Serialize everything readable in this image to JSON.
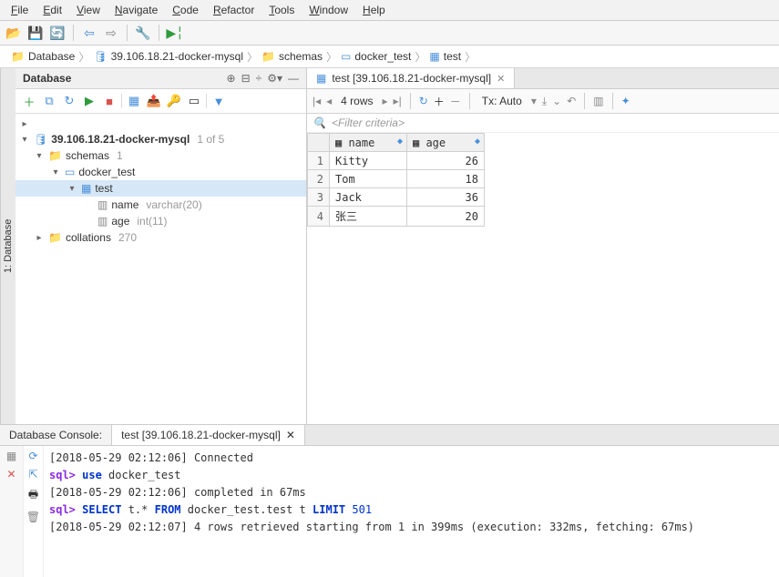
{
  "menu": [
    "File",
    "Edit",
    "View",
    "Navigate",
    "Code",
    "Refactor",
    "Tools",
    "Window",
    "Help"
  ],
  "breadcrumb": [
    {
      "icon": "folder",
      "label": "Database"
    },
    {
      "icon": "db",
      "label": "39.106.18.21-docker-mysql"
    },
    {
      "icon": "folder",
      "label": "schemas"
    },
    {
      "icon": "schema",
      "label": "docker_test"
    },
    {
      "icon": "table",
      "label": "test"
    }
  ],
  "vtab_label": "1: Database",
  "db_panel": {
    "title": "Database",
    "tree": [
      {
        "indent": 0,
        "arrow": "▸",
        "icon": "",
        "label": "",
        "meta": ""
      },
      {
        "indent": 0,
        "arrow": "▾",
        "icon": "db",
        "label": "39.106.18.21-docker-mysql",
        "meta": "1 of 5",
        "bold": true
      },
      {
        "indent": 1,
        "arrow": "▾",
        "icon": "folder",
        "label": "schemas",
        "meta": "1"
      },
      {
        "indent": 2,
        "arrow": "▾",
        "icon": "schema",
        "label": "docker_test",
        "meta": ""
      },
      {
        "indent": 3,
        "arrow": "▾",
        "icon": "table",
        "label": "test",
        "meta": "",
        "sel": true
      },
      {
        "indent": 4,
        "arrow": "",
        "icon": "col",
        "label": "name",
        "meta": "varchar(20)"
      },
      {
        "indent": 4,
        "arrow": "",
        "icon": "col",
        "label": "age",
        "meta": "int(11)"
      },
      {
        "indent": 1,
        "arrow": "▸",
        "icon": "folder",
        "label": "collations",
        "meta": "270"
      },
      {
        "indent": 0,
        "arrow": "",
        "icon": "",
        "label": "",
        "meta": ""
      }
    ]
  },
  "editor_tab": "test [39.106.18.21-docker-mysql]",
  "data_toolbar": {
    "rows_label": "4 rows",
    "tx_label": "Tx: Auto"
  },
  "filter_placeholder": "<Filter criteria>",
  "columns": [
    "name",
    "age"
  ],
  "rows": [
    {
      "n": 1,
      "name": "Kitty",
      "age": 26
    },
    {
      "n": 2,
      "name": "Tom",
      "age": 18
    },
    {
      "n": 3,
      "name": "Jack",
      "age": 36
    },
    {
      "n": 4,
      "name": "张三",
      "age": 20
    }
  ],
  "console": {
    "title1": "Database Console:",
    "title2": "test [39.106.18.21-docker-mysql]",
    "lines": [
      {
        "ts": "[2018-05-29 02:12:06]",
        "text": " Connected"
      },
      {
        "prompt": "sql>",
        "sql": " use",
        "rest": " docker_test"
      },
      {
        "ts": "[2018-05-29 02:12:06]",
        "text": " completed in 67ms"
      },
      {
        "prompt": "sql>",
        "sql": " SELECT",
        "rest1": " t.*",
        "sql2": " FROM",
        "rest2": " docker_test.test t",
        "sql3": " LIMIT",
        "num": " 501"
      },
      {
        "ts": "[2018-05-29 02:12:07]",
        "text": " 4 rows retrieved starting from 1 in 399ms (execution: 332ms, fetching: 67ms)"
      }
    ]
  }
}
